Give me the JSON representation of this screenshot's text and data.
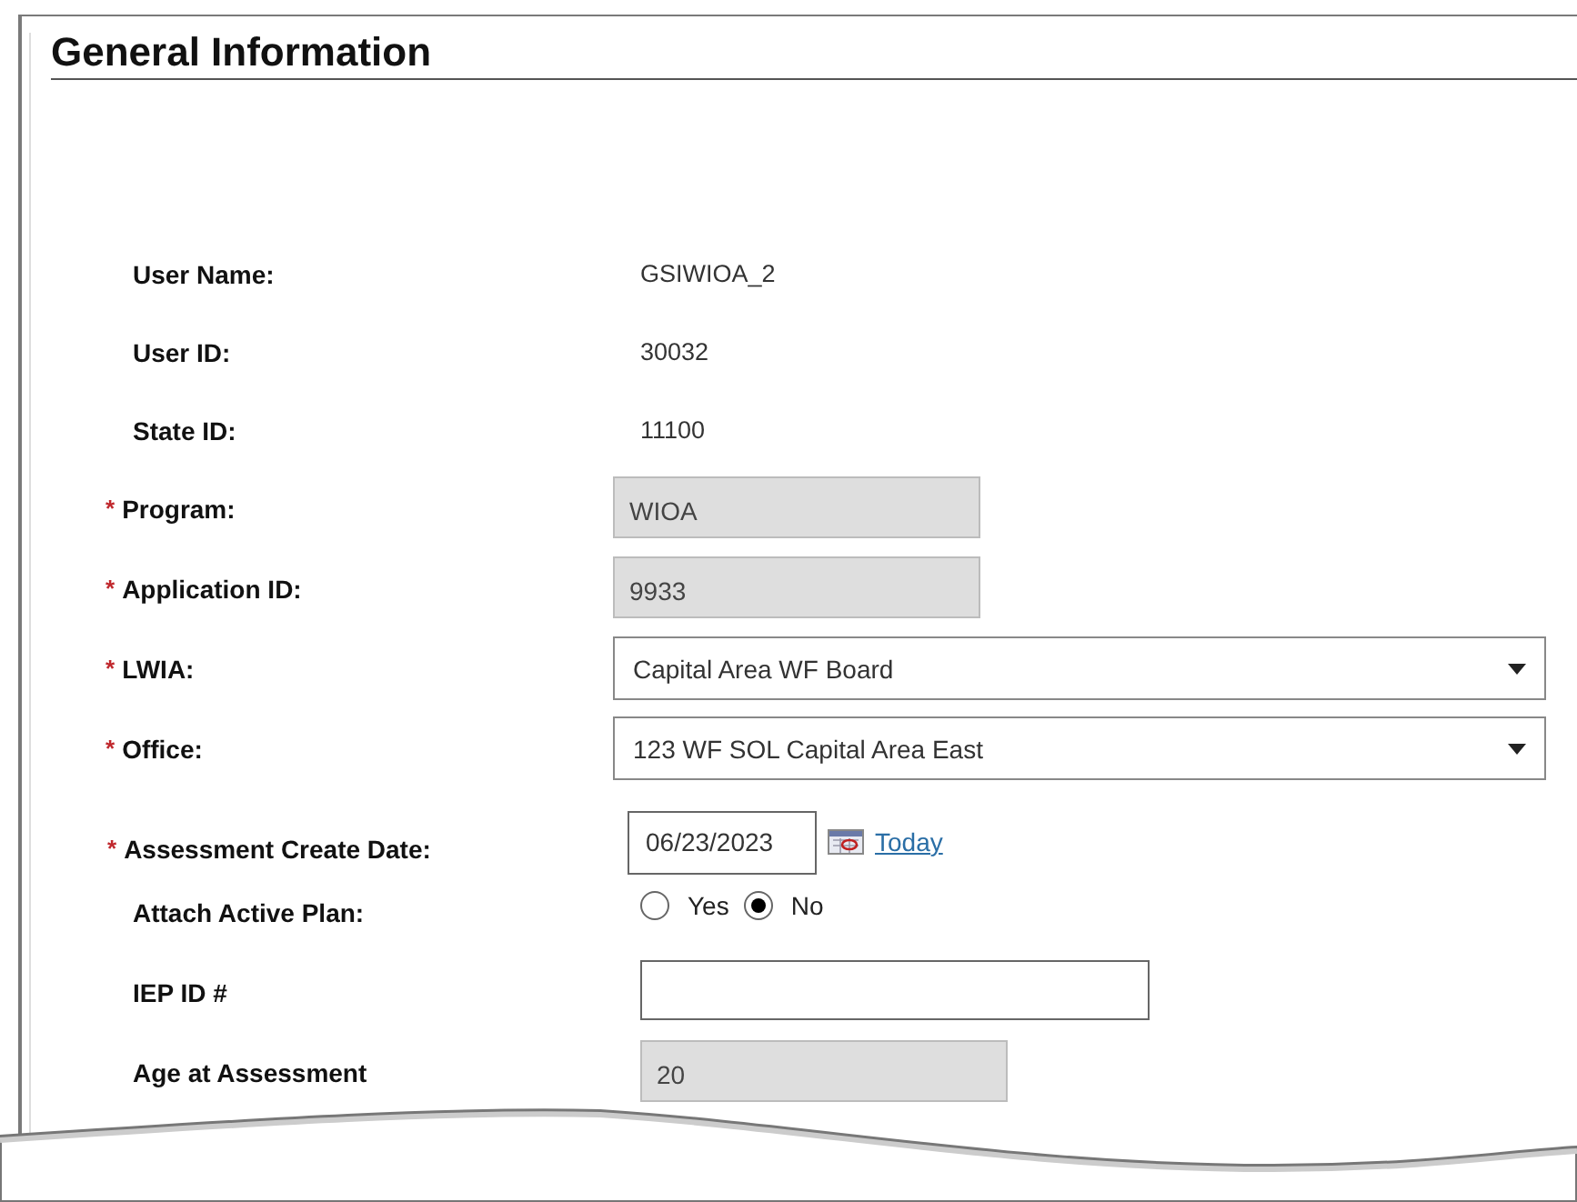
{
  "section": {
    "title": "General Information"
  },
  "fields": [
    {
      "kind": "text",
      "label": "User Name:",
      "value": "GSIWIOA_2"
    },
    {
      "kind": "text",
      "label": "User ID:",
      "value": "30032"
    },
    {
      "kind": "text",
      "label": "State ID:",
      "value": "11100"
    },
    {
      "kind": "readonly",
      "label": "Program:",
      "required_mark": "*",
      "value": "WIOA"
    },
    {
      "kind": "readonly",
      "label": "Application ID:",
      "required_mark": "*",
      "value": "9933"
    },
    {
      "kind": "select",
      "label": "LWIA:",
      "required_mark": "*",
      "value": "Capital Area WF Board"
    },
    {
      "kind": "select",
      "label": "Office:",
      "required_mark": "*",
      "value": "123 WF SOL Capital Area East"
    },
    {
      "kind": "date",
      "label": "Assessment Create Date:",
      "required_mark": "*",
      "value": "06/23/2023",
      "link": "Today"
    },
    {
      "kind": "radio",
      "label": "Attach Active Plan:",
      "options": [
        {
          "label": "Yes",
          "selected": false
        },
        {
          "label": "No",
          "selected": true
        }
      ]
    },
    {
      "kind": "input",
      "label": "IEP ID #"
    },
    {
      "kind": "readonly",
      "label": "Age at Assessment",
      "value": "20"
    }
  ]
}
